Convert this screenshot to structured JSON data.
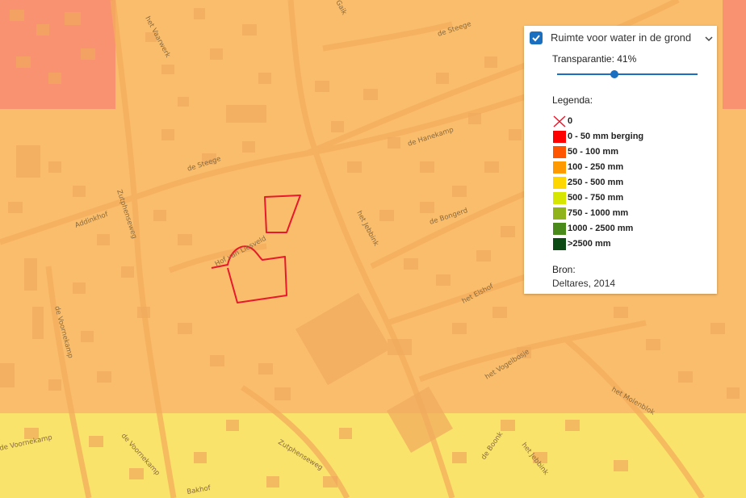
{
  "map": {
    "zone_colors": {
      "red": "#f99270",
      "orange": "#f9bd6c",
      "yellow": "#f9e36b",
      "road": "#f4ad5b",
      "building": "#f1aa5e"
    },
    "street_labels": [
      "het Vaarwerk",
      "de Steege",
      "Gaik",
      "de Hanekamp",
      "de Steege",
      "Addinkhof",
      "Zutphenseweg",
      "Hof van Liesveld",
      "het Jebbink",
      "de Bongerd",
      "het Elshof",
      "het Vogelbosje",
      "het Molenblok",
      "de Voornekamp",
      "de Voornekamp",
      "de Voornekamp",
      "Zutphenseweg",
      "de Boonk",
      "het Jebbink",
      "Bakhof"
    ],
    "plot_outline_color": "#e8192c"
  },
  "layer_panel": {
    "checked": true,
    "title": "Ruimte voor water in de grond",
    "transparency_label": "Transparantie: 41%",
    "transparency_value": 0.41,
    "legend_title": "Legenda:",
    "legend": [
      {
        "label": "0",
        "color": "#ff0000",
        "symbol": "cross"
      },
      {
        "label": "0 - 50 mm berging",
        "color": "#ff0000"
      },
      {
        "label": "50 - 100 mm",
        "color": "#ff5500"
      },
      {
        "label": "100 - 250 mm",
        "color": "#ff9900"
      },
      {
        "label": "250 - 500 mm",
        "color": "#ffd700"
      },
      {
        "label": "500 - 750 mm",
        "color": "#d6e600"
      },
      {
        "label": "750 - 1000 mm",
        "color": "#8fb31a"
      },
      {
        "label": "1000 - 2500 mm",
        "color": "#4a8a1a"
      },
      {
        "label": ">2500 mm",
        "color": "#0b4a12"
      }
    ],
    "source_title": "Bron:",
    "source_text": "Deltares, 2014"
  }
}
